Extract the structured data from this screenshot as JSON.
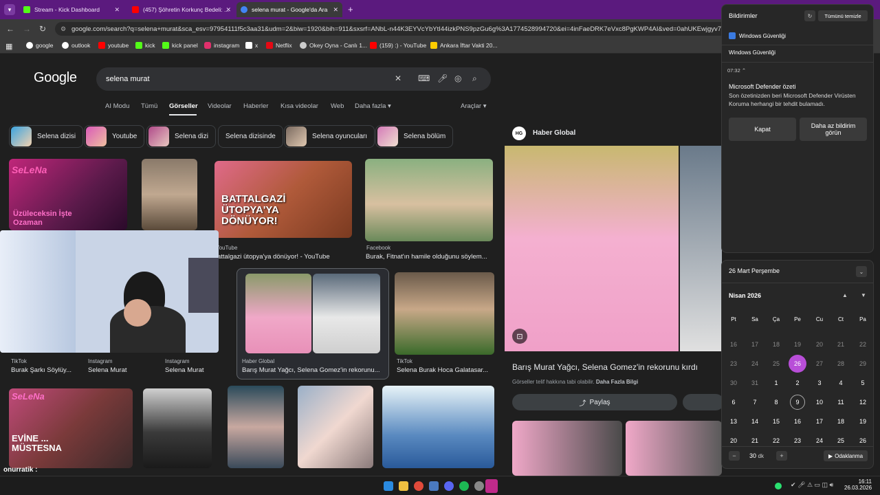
{
  "browser": {
    "tabs": [
      {
        "title": "Stream - Kick Dashboard",
        "color": "#53fc18",
        "active": false
      },
      {
        "title": "(457) Şöhretin Korkunç Bedeli: ...",
        "color": "#ff0000",
        "active": false
      },
      {
        "title": "selena murat - Google'da Ara",
        "color": "#4285f4",
        "active": true
      }
    ],
    "url": "google.com/search?q=selena+murat&sca_esv=97954111f5c3aa31&udm=2&biw=1920&bih=911&sxsrf=ANbL-n44K3EYVcYbYtI44izkPNS9pzGu6g%3A1774528994720&ei=4inFaeDRK7eVxc8PgKWP4AI&ved=0ahUKEwjgyv7Sy72...",
    "bookmarks": [
      {
        "label": "google",
        "color": "#ffffff"
      },
      {
        "label": "outlook",
        "color": "#ffffff"
      },
      {
        "label": "youtube",
        "color": "#ff0000"
      },
      {
        "label": "kick",
        "color": "#53fc18"
      },
      {
        "label": "kick panel",
        "color": "#53fc18"
      },
      {
        "label": "instagram",
        "color": "#e1306c"
      },
      {
        "label": "x",
        "color": "#ffffff"
      },
      {
        "label": "Netflix",
        "color": "#e50914"
      },
      {
        "label": "Okey Oyna - Canlı 1...",
        "color": "#cccccc"
      },
      {
        "label": "(159) :) - YouTube",
        "color": "#ff0000"
      },
      {
        "label": "Ankara İftar Vakti 20...",
        "color": "#ffcc00"
      }
    ]
  },
  "google": {
    "logo": "Google",
    "query": "selena murat",
    "tabs": [
      "AI Modu",
      "Tümü",
      "Görseller",
      "Videolar",
      "Haberler",
      "Kısa videolar",
      "Web",
      "Daha fazla ▾"
    ],
    "tools": "Araçlar ▾",
    "chips": [
      "Selena dizisi",
      "Youtube",
      "Selena dizi",
      "Selena dizisinde",
      "Selena oyuncuları",
      "Selena bölüm"
    ],
    "results": [
      {
        "source": "YouTube",
        "caption": "attalgazi ütopya'ya dönüyor! - YouTube",
        "overlay": "BATTALGAZİ ÜTOPYA'YA DÖNÜYOR!"
      },
      {
        "source": "Facebook",
        "caption": "Burak, Fitnat'ın hamile olduğunu söylem..."
      },
      {
        "source": "TikTok",
        "caption": "Burak Şarkı Söylüy..."
      },
      {
        "source": "Instagram",
        "caption": "Selena Murat"
      },
      {
        "source": "Instagram",
        "caption": "Selena Murat"
      },
      {
        "source": "Haber Global",
        "caption": "Barış Murat Yağcı, Selena Gomez'in rekorunu..."
      },
      {
        "source": "TikTok",
        "caption": "Selena Burak Hoca Galatasar..."
      }
    ],
    "overlay_texts": {
      "r1": "Üzüleceksin İşte Ozaman",
      "r5": "EVİNE ... MÜSTESNA",
      "selena_logo": "SeLeNa"
    },
    "panel": {
      "source": "Haber Global",
      "source_badge": "HG",
      "title": "Barış Murat Yağcı, Selena Gomez'in rekorunu kırdı",
      "disclaimer": "Görseller telif hakkına tabi olabilir.",
      "more": "Daha Fazla Bilgi",
      "share": "Paylaş"
    }
  },
  "notifications": {
    "header": "Bildirimler",
    "clear": "Tümünü temizle",
    "app": "Windows Güvenliği",
    "group": "Windows Güvenliği",
    "time": "07:32",
    "title": "Microsoft Defender özeti",
    "body": "Son özetinizden beri Microsoft Defender Virüsten Koruma herhangi bir tehdit bulamadı.",
    "btn_close": "Kapat",
    "btn_less": "Daha az bildirim görün"
  },
  "calendar": {
    "date_header": "26 Mart Perşembe",
    "month": "Nisan 2026",
    "weekdays": [
      "Pt",
      "Sa",
      "Ça",
      "Pe",
      "Cu",
      "Ct",
      "Pa"
    ],
    "days": [
      [
        "16",
        "17",
        "18",
        "19",
        "20",
        "21",
        "22"
      ],
      [
        "23",
        "24",
        "25",
        "26",
        "27",
        "28",
        "29"
      ],
      [
        "30",
        "31",
        "1",
        "2",
        "3",
        "4",
        "5"
      ],
      [
        "6",
        "7",
        "8",
        "9",
        "10",
        "11",
        "12"
      ],
      [
        "13",
        "14",
        "15",
        "16",
        "17",
        "18",
        "19"
      ],
      [
        "20",
        "21",
        "22",
        "23",
        "24",
        "25",
        "26"
      ]
    ],
    "focus_value": "30",
    "focus_unit": "dk",
    "focus_btn": "Odaklanma"
  },
  "stream": {
    "chat_user": "onurratik :"
  },
  "taskbar": {
    "time": "16:11",
    "date": "26.03.2026"
  }
}
